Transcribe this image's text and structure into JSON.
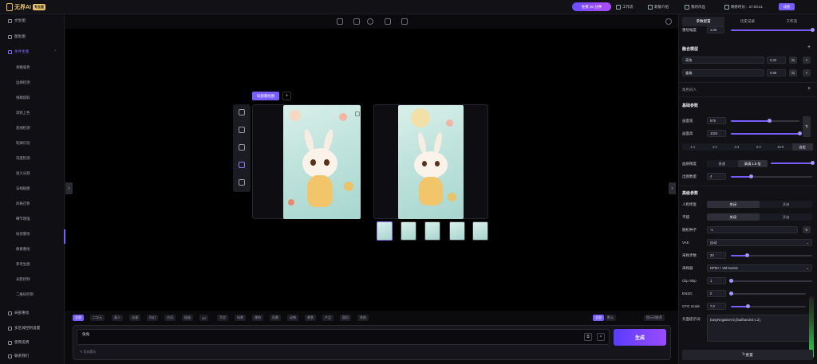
{
  "app": {
    "logo_text": "无界AI",
    "logo_badge": "专业版",
    "credits": "免费 30 分钟",
    "links": [
      "工作流",
      "新版介绍",
      "我的作品"
    ],
    "timer": "剩余时长：37:00:41",
    "vip_label": "续费"
  },
  "sidebar": {
    "items": [
      {
        "label": "文生图"
      },
      {
        "label": "图生图"
      },
      {
        "label": "条件生图"
      }
    ],
    "sub_items": [
      "骨骼姿势",
      "边缘检测",
      "线稿提取",
      "涂鸦上色",
      "直线检测",
      "轮廓识别",
      "深度检测",
      "语义分割",
      "法线贴图",
      "风格迁移",
      "细节增强",
      "局部重绘",
      "像素重绘",
      "参考生图",
      "光影控制",
      "二维码控制"
    ],
    "active_sub": "局部重绘",
    "footer_items": [
      "局部重绘",
      "多区域控制设置",
      "使用说明",
      "联系我们"
    ]
  },
  "canvas": {
    "ref_tab": "局部重绘图",
    "add_label": "+",
    "tool_icons": [
      "undo-icon",
      "redo-icon",
      "move-icon",
      "brush-icon",
      "eraser-icon"
    ],
    "top_icons": [
      "image-icon",
      "crop-icon",
      "settings-icon",
      "hand-icon",
      "fullscreen-icon"
    ]
  },
  "chips": [
    "全部",
    "二次元",
    "真人",
    "动漫",
    "科幻",
    "古风",
    "插画",
    "3D",
    "写实",
    "场景",
    "建筑",
    "风景",
    "动物",
    "美食",
    "产品",
    "国风",
    "其他"
  ],
  "chips_active": "全部",
  "chips_right": [
    "全部",
    "默认",
    "提示词推荐"
  ],
  "prompt": {
    "value": "兔兔",
    "negative_label": "负向提示",
    "generate_label": "生成"
  },
  "rpanel": {
    "tabs": [
      "参数配置",
      "历史记录",
      "工作流"
    ],
    "active_tab": "参数配置",
    "strength_label": "重绘幅度",
    "strength_value": "1.00",
    "lora_title": "融合模型",
    "lora_rows": [
      {
        "name": "萌兔",
        "value": "0.33"
      },
      {
        "name": "童趣",
        "value": "0.59"
      }
    ],
    "role_title": "角色同人",
    "size_title": "基础参数",
    "width_label": "画面宽",
    "width_value": "576",
    "height_label": "画面高",
    "height_value": "1024",
    "ratios": [
      "1:1",
      "1:2",
      "4:3",
      "2:3",
      "16:9",
      "自定"
    ],
    "scale_label": "画质精度",
    "scale_options": [
      "普通",
      "高清 1.5 倍"
    ],
    "count_label": "出图数量",
    "count_value": "4",
    "adv_title": "高级参数",
    "hires_label": "人脸修复",
    "hires_options": [
      "关闭",
      "开启"
    ],
    "tile_label": "平铺",
    "tile_options": [
      "关闭",
      "开启"
    ],
    "seed_label": "随机种子",
    "seed_value": "-1",
    "vae_label": "VAE",
    "vae_value": "自动",
    "steps_label": "采样步数",
    "steps_value": "20",
    "sampler_label": "采样器",
    "sampler_value": "DPM++ 2M Karras",
    "clip_label": "Clip Skip",
    "clip_value": "1",
    "ensd_label": "ENSD",
    "ensd_value": "0",
    "cfg_label": "CFG Scale",
    "cfg_value": "7.0",
    "neg_label": "负面提示词",
    "neg_value": "EasyNegativeV2,(badhandv4:1.2),",
    "reset_label": "重置"
  },
  "sliders": {
    "strength": 1.0,
    "width": 0.56,
    "height": 1.0,
    "scale": 1.0,
    "count": 0.25,
    "steps": 0.2,
    "clip": 0.0,
    "ensd": 0.0,
    "cfg": 0.23
  },
  "colors": {
    "accent": "#7a5cff",
    "bg": "#000000",
    "panel": "#111116"
  }
}
